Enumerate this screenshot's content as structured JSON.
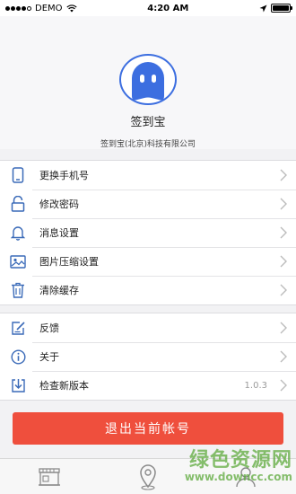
{
  "status_bar": {
    "carrier": "DEMO",
    "time": "4:20 AM"
  },
  "profile": {
    "app_name": "签到宝",
    "company": "签到宝(北京)科技有限公司"
  },
  "settings_group": [
    {
      "icon": "phone-icon",
      "label": "更换手机号"
    },
    {
      "icon": "lock-icon",
      "label": "修改密码"
    },
    {
      "icon": "bell-icon",
      "label": "消息设置"
    },
    {
      "icon": "image-icon",
      "label": "图片压缩设置"
    },
    {
      "icon": "trash-icon",
      "label": "清除缓存"
    }
  ],
  "info_group": [
    {
      "icon": "edit-icon",
      "label": "反馈"
    },
    {
      "icon": "info-icon",
      "label": "关于"
    },
    {
      "icon": "download-icon",
      "label": "检查新版本",
      "value": "1.0.3"
    }
  ],
  "logout_label": "退出当前帐号",
  "tabbar": [
    {
      "icon": "store-icon"
    },
    {
      "icon": "location-icon"
    },
    {
      "icon": "person-icon"
    }
  ],
  "watermark": {
    "main": "绿色资源网",
    "sub": "www.downcc.com"
  },
  "colors": {
    "accent": "#3c6ee0",
    "logout": "#ef4f3d",
    "icon": "#3a6ab8"
  }
}
